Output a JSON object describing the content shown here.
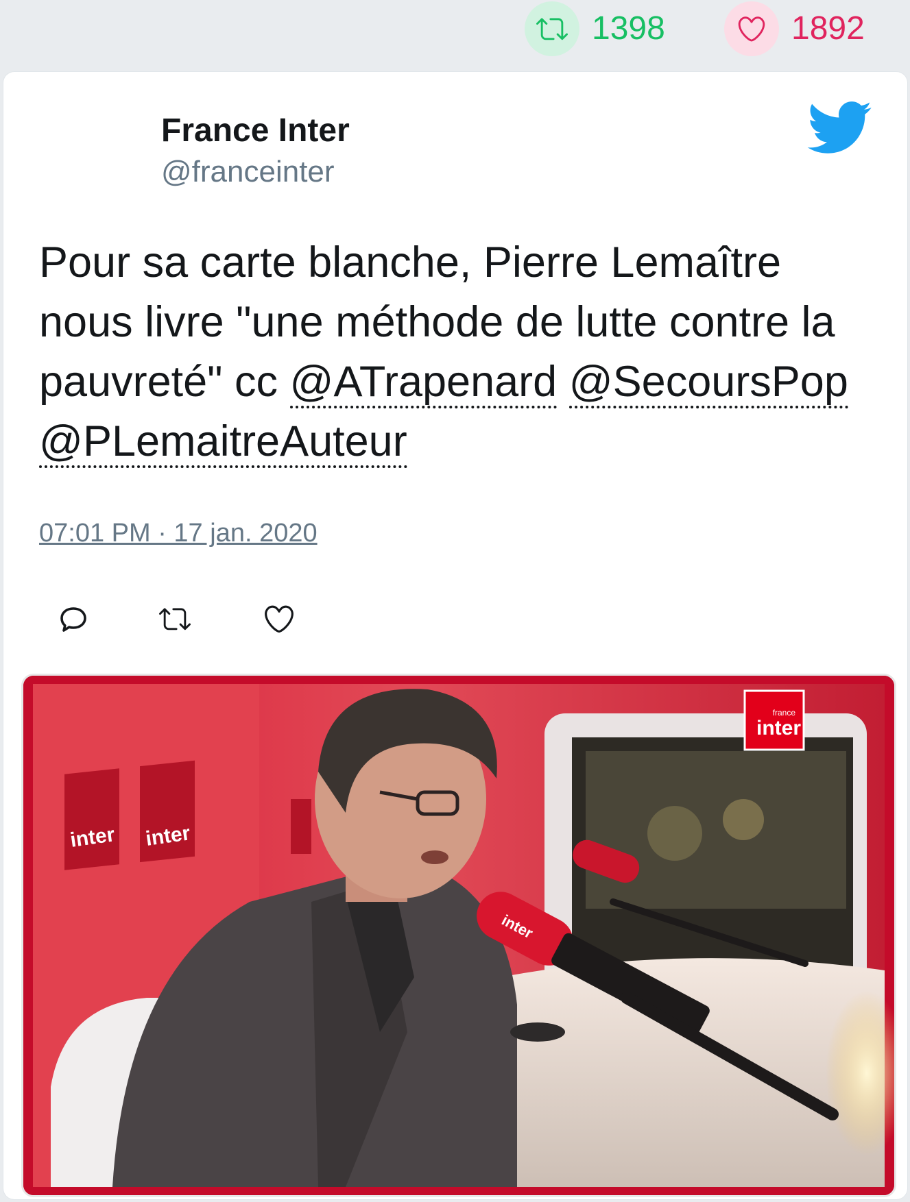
{
  "stats": {
    "retweets": {
      "count": "1398",
      "icon": "retweet-icon",
      "color": "#17bf63",
      "bg": "#d1f2e0"
    },
    "likes": {
      "count": "1892",
      "icon": "heart-icon",
      "color": "#e0245e",
      "bg": "#fcdce6"
    }
  },
  "tweet": {
    "author_name": "France Inter",
    "author_handle": "@franceinter",
    "text_plain": "Pour sa carte blanche, Pierre Lemaître nous livre \"une méthode de lutte contre la pauvreté\" cc ",
    "mentions": [
      "@ATrapenard",
      "@SecoursPop",
      "@PLemaitreAuteur"
    ],
    "timestamp": "07:01 PM · 17 jan. 2020",
    "brand_color": "#1da1f2"
  },
  "actions": [
    {
      "name": "reply",
      "icon": "reply-icon"
    },
    {
      "name": "retweet",
      "icon": "retweet-icon"
    },
    {
      "name": "like",
      "icon": "heart-icon"
    }
  ],
  "media": {
    "type": "image",
    "logo_small_text": "france",
    "logo_text": "inter",
    "accent_color": "#e2001a"
  }
}
